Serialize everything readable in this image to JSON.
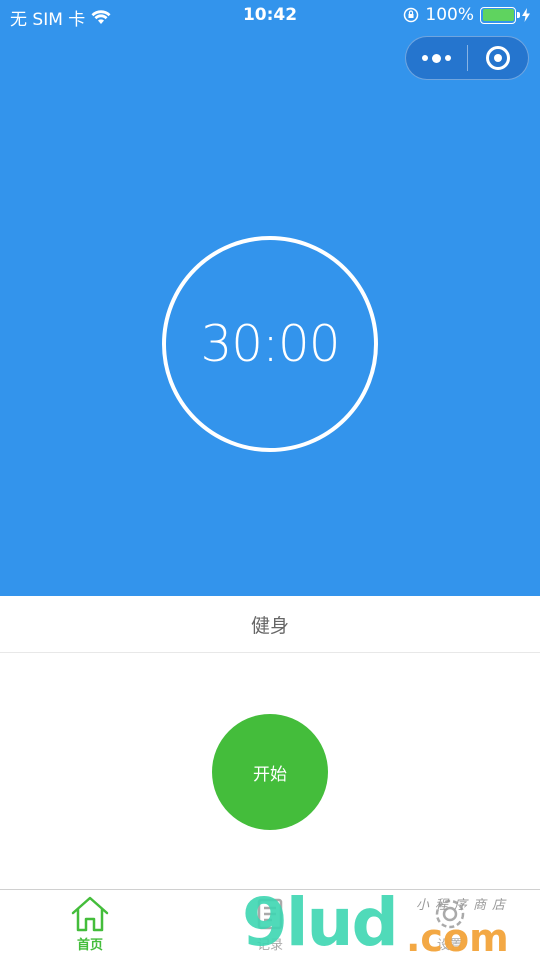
{
  "status_bar": {
    "carrier": "无 SIM 卡",
    "time": "10:42",
    "battery": "100%",
    "battery_level": 100
  },
  "timer": {
    "display": "30:00"
  },
  "mode": {
    "label": "健身"
  },
  "actions": {
    "start_label": "开始"
  },
  "tabbar": {
    "items": [
      {
        "label": "首页",
        "icon": "home-icon",
        "active": true
      },
      {
        "label": "记录",
        "icon": "record-icon",
        "active": false
      },
      {
        "label": "设置",
        "icon": "settings-icon",
        "active": false
      }
    ]
  },
  "watermark": {
    "main": "9lud",
    "suffix": ".com",
    "small": "小程序商店"
  },
  "colors": {
    "primary_blue": "#3394ec",
    "accent_green": "#44bd3b"
  }
}
